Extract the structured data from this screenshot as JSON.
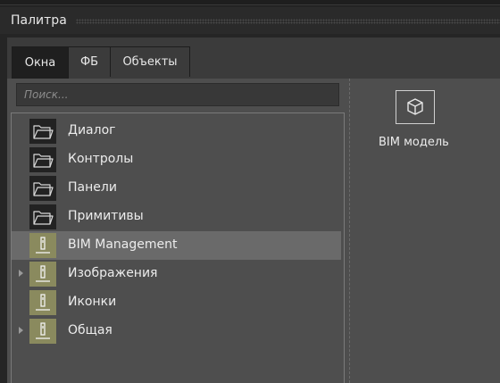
{
  "window": {
    "title": "Палитра"
  },
  "tabs": [
    {
      "label": "Окна",
      "active": true
    },
    {
      "label": "ФБ",
      "active": false
    },
    {
      "label": "Объекты",
      "active": false
    }
  ],
  "search": {
    "placeholder": "Поиск..."
  },
  "tree": [
    {
      "label": "Диалог",
      "icon": "folder-icon",
      "expandable": false,
      "selected": false
    },
    {
      "label": "Контролы",
      "icon": "folder-icon",
      "expandable": false,
      "selected": false
    },
    {
      "label": "Панели",
      "icon": "folder-icon",
      "expandable": false,
      "selected": false
    },
    {
      "label": "Примитивы",
      "icon": "folder-icon",
      "expandable": false,
      "selected": false
    },
    {
      "label": "BIM Management",
      "icon": "bim-library-icon",
      "expandable": false,
      "selected": true
    },
    {
      "label": "Изображения",
      "icon": "bim-library-icon",
      "expandable": true,
      "selected": false
    },
    {
      "label": "Иконки",
      "icon": "bim-library-icon",
      "expandable": false,
      "selected": false
    },
    {
      "label": "Общая",
      "icon": "bim-library-icon",
      "expandable": true,
      "selected": false
    }
  ],
  "palette_items": [
    {
      "label": "BIM модель",
      "icon": "cube-icon"
    }
  ]
}
